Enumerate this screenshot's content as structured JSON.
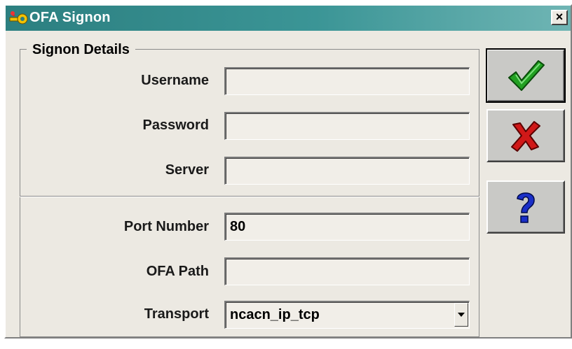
{
  "window": {
    "title": "OFA Signon",
    "close_label": "×"
  },
  "group": {
    "title": "Signon Details"
  },
  "fields": {
    "username": {
      "label": "Username",
      "value": ""
    },
    "password": {
      "label": "Password",
      "value": ""
    },
    "server": {
      "label": "Server",
      "value": ""
    },
    "port": {
      "label": "Port Number",
      "value": "80"
    },
    "ofa_path": {
      "label": "OFA Path",
      "value": ""
    },
    "transport": {
      "label": "Transport",
      "value": "ncacn_ip_tcp"
    }
  },
  "buttons": {
    "ok_icon": "green-checkmark-icon",
    "cancel_icon": "red-x-icon",
    "help_icon": "question-mark-icon"
  },
  "colors": {
    "titlebar": "#2c7f80",
    "check": "#1e8a1e",
    "cross": "#c81414",
    "help": "#1a2fc8"
  }
}
